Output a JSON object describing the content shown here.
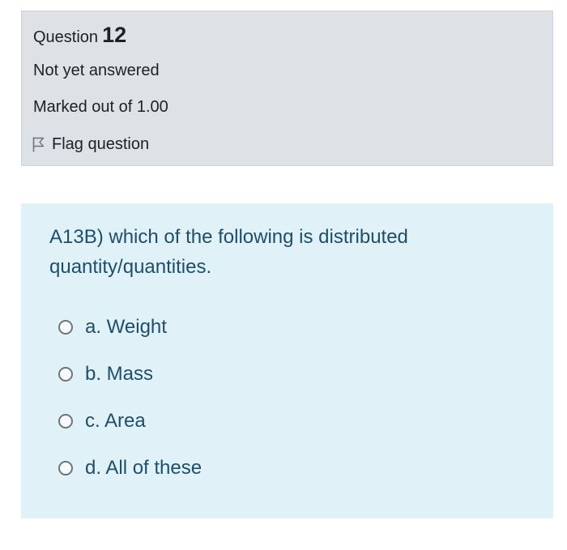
{
  "question_info": {
    "label": "Question",
    "number": "12",
    "state": "Not yet answered",
    "grade": "Marked out of 1.00",
    "flag_label": "Flag question"
  },
  "formulation": {
    "question_text": "A13B) which of the following is distributed quantity/quantities.",
    "answers": [
      {
        "label": "a. Weight",
        "selected": false
      },
      {
        "label": "b. Mass",
        "selected": false
      },
      {
        "label": "c. Area",
        "selected": false
      },
      {
        "label": "d. All of these",
        "selected": false
      }
    ]
  },
  "colors": {
    "info_background": "#dee2e6",
    "formulation_background": "#e1f1f8",
    "question_text_color": "#1e4e6b"
  },
  "icons": {
    "flag": "flag-outline-icon"
  }
}
